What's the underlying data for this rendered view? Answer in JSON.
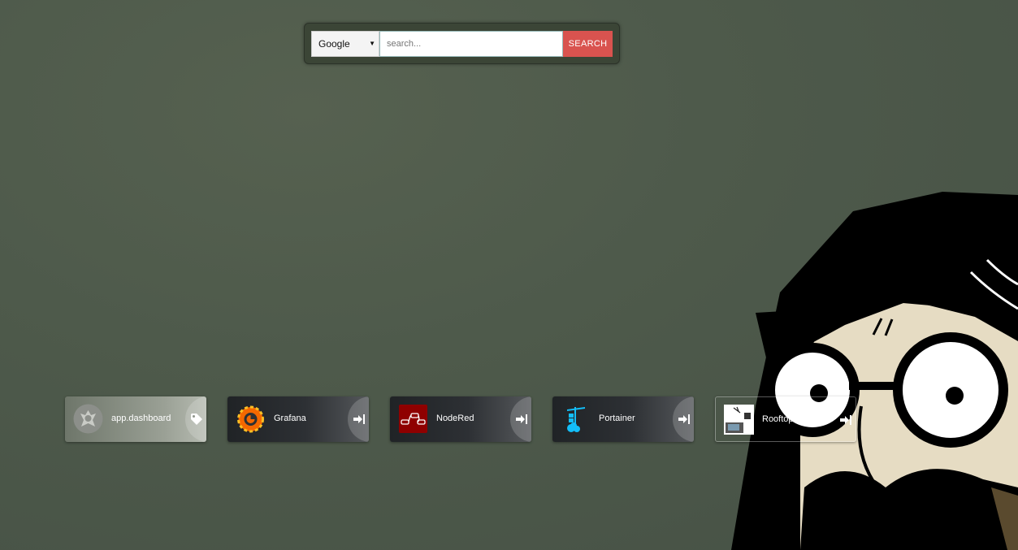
{
  "search": {
    "engine_selected": "Google",
    "placeholder": "search...",
    "button_label": "SEARCH"
  },
  "apps": [
    {
      "name": "app.dashboard",
      "icon": "dashboard-logo-icon",
      "action_icon": "tag-icon"
    },
    {
      "name": "Grafana",
      "icon": "grafana-logo-icon",
      "action_icon": "open-icon"
    },
    {
      "name": "NodeRed",
      "icon": "nodered-logo-icon",
      "action_icon": "open-icon"
    },
    {
      "name": "Portainer",
      "icon": "portainer-logo-icon",
      "action_icon": "open-icon"
    },
    {
      "name": "Rooftop",
      "icon": "rooftop-image-icon",
      "action_icon": "open-icon"
    }
  ],
  "colors": {
    "search_button": "#d9534f",
    "background": "#4e5a4b"
  }
}
